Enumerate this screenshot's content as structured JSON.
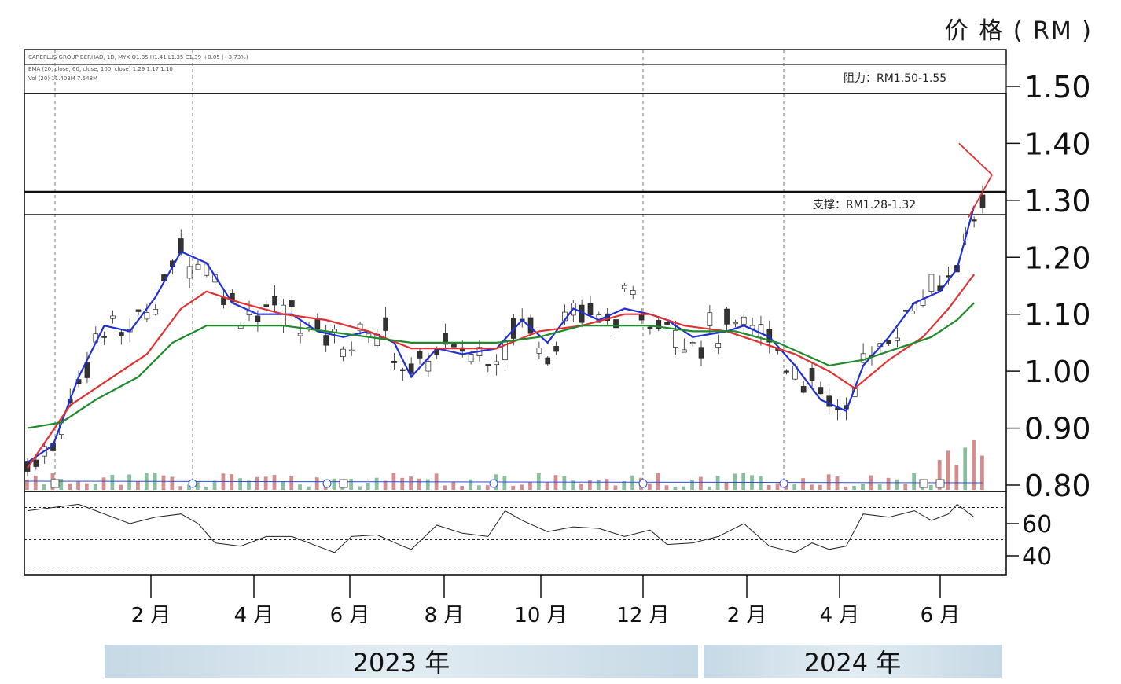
{
  "price_unit": "价 格 ( RM )",
  "header_lines": [
    "CAREPLUS GROUP BERHAD, 1D, MYX  O1.35 H1.41 L1.35 C1.39 +0.05 (+3.73%)",
    "EMA (20, close, 60, close, 100, close)  1.29  1.17  1.10",
    "Vol (20)  11.403M  7.548M"
  ],
  "annotations": {
    "resistance": "阻力：RM1.50-1.55",
    "support": "支撑：RM1.28-1.32"
  },
  "colors": {
    "ema_fast": "#1f2fd6",
    "ema_mid": "#e03232",
    "ema_slow": "#1f8a2a",
    "candle_up": "#2a8a4a",
    "candle_down": "#b03030",
    "triangle": "#e03232",
    "year_bar": "#c6d9e6"
  },
  "chart_data": {
    "type": "candlestick",
    "title": "",
    "ylabel": "价 格 ( RM )",
    "price_axis_ticks": [
      "1.50",
      "1.40",
      "1.30",
      "1.20",
      "1.10",
      "1.00",
      "0.90",
      "0.80"
    ],
    "rsi_axis_ticks": [
      "60",
      "40"
    ],
    "x_tick_labels": [
      "2 月",
      "4 月",
      "6 月",
      "8 月",
      "10 月",
      "12 月",
      "2 月",
      "4 月",
      "6 月"
    ],
    "year_labels": [
      "2023 年",
      "2024 年"
    ],
    "ylim": [
      0.8,
      1.52
    ],
    "resistance_band": [
      1.5,
      1.55
    ],
    "support_band": [
      1.28,
      1.32
    ],
    "series": [
      {
        "name": "EMA 20",
        "points": [
          [
            0,
            0.84
          ],
          [
            3,
            0.87
          ],
          [
            6,
            0.99
          ],
          [
            9,
            1.08
          ],
          [
            12,
            1.07
          ],
          [
            15,
            1.13
          ],
          [
            18,
            1.21
          ],
          [
            21,
            1.19
          ],
          [
            24,
            1.12
          ],
          [
            27,
            1.1
          ],
          [
            31,
            1.1
          ],
          [
            34,
            1.07
          ],
          [
            37,
            1.06
          ],
          [
            40,
            1.07
          ],
          [
            43,
            1.05
          ],
          [
            45,
            0.99
          ],
          [
            48,
            1.04
          ],
          [
            51,
            1.03
          ],
          [
            55,
            1.04
          ],
          [
            58,
            1.09
          ],
          [
            61,
            1.05
          ],
          [
            64,
            1.11
          ],
          [
            67,
            1.09
          ],
          [
            70,
            1.11
          ],
          [
            73,
            1.1
          ],
          [
            75,
            1.09
          ],
          [
            78,
            1.06
          ],
          [
            82,
            1.07
          ],
          [
            84,
            1.08
          ],
          [
            87,
            1.06
          ],
          [
            90,
            1.01
          ],
          [
            93,
            0.95
          ],
          [
            96,
            0.93
          ],
          [
            98,
            1.01
          ],
          [
            101,
            1.06
          ],
          [
            104,
            1.12
          ],
          [
            107,
            1.14
          ],
          [
            109,
            1.18
          ],
          [
            111,
            1.29
          ]
        ]
      },
      {
        "name": "EMA 60",
        "points": [
          [
            0,
            0.83
          ],
          [
            5,
            0.94
          ],
          [
            9,
            0.98
          ],
          [
            14,
            1.03
          ],
          [
            18,
            1.11
          ],
          [
            21,
            1.14
          ],
          [
            25,
            1.12
          ],
          [
            30,
            1.1
          ],
          [
            35,
            1.09
          ],
          [
            40,
            1.07
          ],
          [
            45,
            1.04
          ],
          [
            50,
            1.04
          ],
          [
            55,
            1.04
          ],
          [
            60,
            1.07
          ],
          [
            65,
            1.08
          ],
          [
            70,
            1.1
          ],
          [
            73,
            1.1
          ],
          [
            77,
            1.08
          ],
          [
            82,
            1.07
          ],
          [
            86,
            1.05
          ],
          [
            90,
            1.03
          ],
          [
            94,
            1.0
          ],
          [
            97,
            0.97
          ],
          [
            101,
            1.02
          ],
          [
            105,
            1.06
          ],
          [
            108,
            1.11
          ],
          [
            111,
            1.17
          ]
        ]
      },
      {
        "name": "EMA 100",
        "points": [
          [
            0,
            0.9
          ],
          [
            4,
            0.91
          ],
          [
            8,
            0.95
          ],
          [
            13,
            0.99
          ],
          [
            17,
            1.05
          ],
          [
            21,
            1.08
          ],
          [
            25,
            1.08
          ],
          [
            30,
            1.08
          ],
          [
            35,
            1.07
          ],
          [
            40,
            1.06
          ],
          [
            45,
            1.05
          ],
          [
            50,
            1.05
          ],
          [
            55,
            1.05
          ],
          [
            60,
            1.06
          ],
          [
            65,
            1.08
          ],
          [
            70,
            1.08
          ],
          [
            73,
            1.08
          ],
          [
            78,
            1.07
          ],
          [
            83,
            1.07
          ],
          [
            88,
            1.05
          ],
          [
            94,
            1.01
          ],
          [
            98,
            1.02
          ],
          [
            102,
            1.04
          ],
          [
            106,
            1.06
          ],
          [
            109,
            1.09
          ],
          [
            111,
            1.12
          ]
        ]
      }
    ],
    "rsi_points": [
      [
        0,
        68
      ],
      [
        3,
        70
      ],
      [
        6,
        72
      ],
      [
        9,
        66
      ],
      [
        12,
        60
      ],
      [
        15,
        64
      ],
      [
        18,
        66
      ],
      [
        20,
        60
      ],
      [
        22,
        48
      ],
      [
        25,
        46
      ],
      [
        28,
        52
      ],
      [
        31,
        52
      ],
      [
        34,
        46
      ],
      [
        36,
        42
      ],
      [
        38,
        52
      ],
      [
        41,
        53
      ],
      [
        44,
        46
      ],
      [
        45,
        44
      ],
      [
        48,
        59
      ],
      [
        51,
        54
      ],
      [
        54,
        52
      ],
      [
        56,
        68
      ],
      [
        58,
        62
      ],
      [
        61,
        55
      ],
      [
        64,
        58
      ],
      [
        67,
        57
      ],
      [
        70,
        52
      ],
      [
        73,
        56
      ],
      [
        75,
        47
      ],
      [
        78,
        48
      ],
      [
        81,
        52
      ],
      [
        84,
        60
      ],
      [
        87,
        46
      ],
      [
        90,
        42
      ],
      [
        92,
        48
      ],
      [
        94,
        44
      ],
      [
        96,
        46
      ],
      [
        98,
        66
      ],
      [
        101,
        64
      ],
      [
        104,
        68
      ],
      [
        106,
        62
      ],
      [
        108,
        66
      ],
      [
        109,
        72
      ],
      [
        111,
        64
      ]
    ],
    "rsi_levels": [
      70,
      50,
      30
    ],
    "triangle": {
      "high_start": 1.4,
      "low_start": 1.27,
      "apex": 1.345
    },
    "event_markers": [
      "D",
      "E",
      "E",
      "D",
      "E",
      "E",
      "E",
      "D",
      "D"
    ]
  }
}
